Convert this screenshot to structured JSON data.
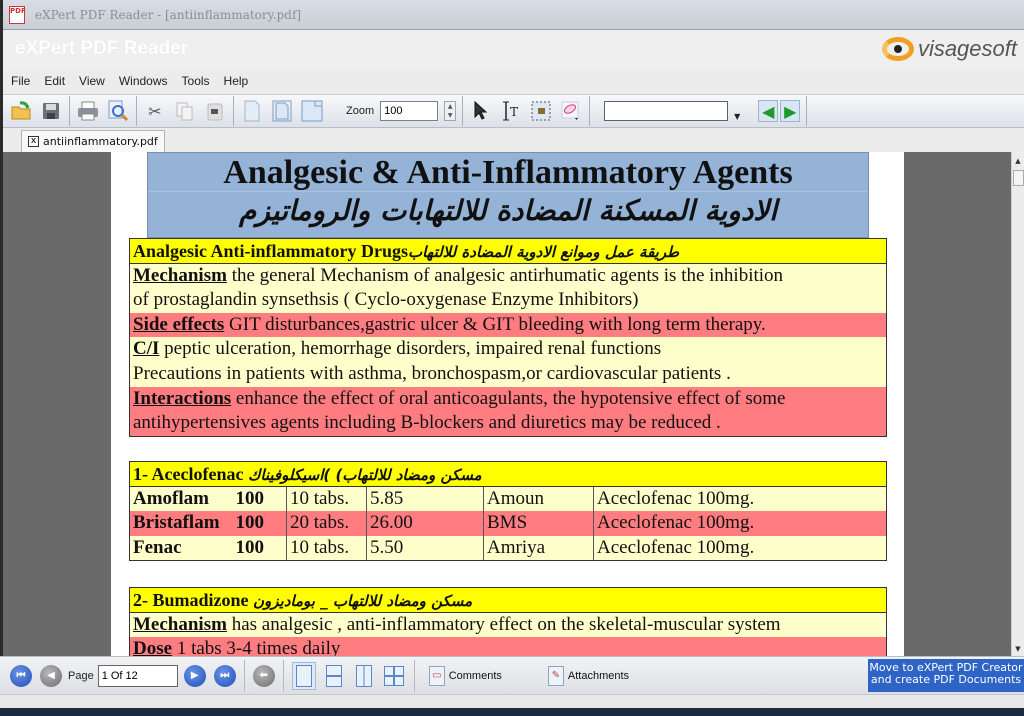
{
  "window": {
    "title": "eXPert PDF Reader - [antiinflammatory.pdf]",
    "app_title": "eXPert PDF Reader",
    "app_icon": "pdf-app-icon",
    "logo_text": "visagesoft"
  },
  "menu": [
    "File",
    "Edit",
    "View",
    "Windows",
    "Tools",
    "Help"
  ],
  "toolbar": {
    "icons": [
      "open-folder-icon",
      "save-icon",
      "print-icon",
      "find-icon",
      "cut-icon",
      "copy-icon",
      "paste-icon",
      "page-view-icon-1",
      "page-view-icon-2",
      "page-view-icon-3",
      "select-arrow-icon",
      "text-select-icon",
      "snapshot-icon",
      "eraser-icon",
      "prev-result-icon",
      "next-result-icon"
    ],
    "zoom_label": "Zoom",
    "zoom_value": "100",
    "search_value": ""
  },
  "tabs": [
    {
      "label": "antiinflammatory.pdf",
      "close": "x"
    }
  ],
  "document": {
    "title_en": "Analgesic & Anti-Inflammatory Agents",
    "title_ar": "الادوية المسكنة المضادة للالتهابات والروماتيزم",
    "section1": {
      "header_en": "Analgesic Anti-inflammatory Drugs",
      "header_ar": "طريقة عمل وموانع الادوية المضادة للالتهاب",
      "mechanism_kw": "Mechanism",
      "mechanism_text1": " the general Mechanism of  analgesic antirhumatic agents is the inhibition",
      "mechanism_text2": "of prostaglandin synsethsis ( Cyclo-oxygenase Enzyme Inhibitors)",
      "side_kw": "Side effects",
      "side_text": "  GIT disturbances,gastric ulcer & GIT bleeding with long term therapy.",
      "ci_kw": "C/I",
      "ci_text": "  peptic ulceration, hemorrhage disorders, impaired renal functions",
      "precautions_text": "Precautions in patients with asthma, bronchospasm,or cardiovascular patients .",
      "interactions_kw": "Interactions",
      "interactions_text1": " enhance the effect of oral anticoagulants, the hypotensive effect of some",
      "interactions_text2": "antihypertensives agents including B-blockers and diuretics may be reduced ."
    },
    "section2": {
      "header_en": "1- Aceclofenac ",
      "header_ar": "مسكن ومضاد للالتهاب) )اسيكلوفيناك",
      "rows": [
        {
          "name": "Amoflam",
          "strength": "100",
          "pack": "10 tabs.",
          "price": "5.85",
          "company": "Amoun",
          "generic": "Aceclofenac 100mg."
        },
        {
          "name": "Bristaflam",
          "strength": "100",
          "pack": "20 tabs.",
          "price": "26.00",
          "company": "BMS",
          "generic": "Aceclofenac 100mg."
        },
        {
          "name": "Fenac",
          "strength": "100",
          "pack": "10 tabs.",
          "price": "5.50",
          "company": "Amriya",
          "generic": "Aceclofenac 100mg."
        }
      ]
    },
    "section3": {
      "header_en": "2- Bumadizone   ",
      "header_ar": "مسكن ومضاد للالتهاب _ بومادیزون",
      "mechanism_kw": "Mechanism",
      "mechanism_text": " has analgesic , anti-inflammatory effect on the skeletal-muscular system",
      "dose_kw": "Dose",
      "dose_text": "  1 tabs  3-4 times daily"
    }
  },
  "statusbar": {
    "page_label": "Page",
    "page_value": "1 Of 12",
    "comments_label": "Comments",
    "attachments_label": "Attachments",
    "promo_line1": "Move to eXPert PDF Creator",
    "promo_line2": "and create PDF Documents"
  },
  "colors": {
    "header_blue": "#95b3d7",
    "highlight_yellow": "#ffff00",
    "row_cream": "#ffffcc",
    "row_pink": "#ff7c80",
    "promo_blue": "#2e64c6",
    "viewer_grey": "#6a6a6a"
  }
}
